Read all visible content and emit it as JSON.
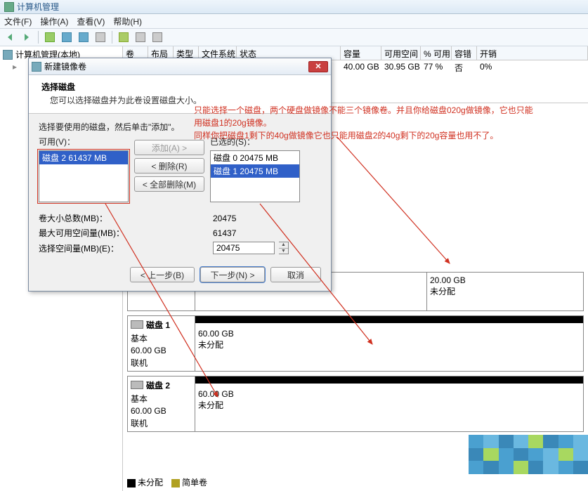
{
  "window": {
    "title": "计算机管理"
  },
  "menu": {
    "file": "文件(F)",
    "action": "操作(A)",
    "view": "查看(V)",
    "help": "帮助(H)"
  },
  "tree": {
    "root": "计算机管理(本地)"
  },
  "columns": {
    "vol": "卷",
    "layout": "布局",
    "type": "类型",
    "fs": "文件系统",
    "status": "状态",
    "cap": "容量",
    "free": "可用空间",
    "pct": "% 可用",
    "fault": "容错",
    "over": "开销"
  },
  "volrow": {
    "cap": "40.00 GB",
    "free": "30.95 GB",
    "pct": "77 %",
    "fault": "否",
    "over": "0%"
  },
  "disk0": {
    "name": "",
    "vol1_size": "",
    "vol1_state": "",
    "vol2_size": "20.00 GB",
    "vol2_state": "未分配"
  },
  "disk1": {
    "name": "磁盘 1",
    "type": "基本",
    "size": "60.00 GB",
    "status": "联机",
    "vol_size": "60.00 GB",
    "vol_state": "未分配"
  },
  "disk2": {
    "name": "磁盘 2",
    "type": "基本",
    "size": "60.00 GB",
    "status": "联机",
    "vol_size": "60.00 GB",
    "vol_state": "未分配"
  },
  "legend": {
    "unalloc": "未分配",
    "simple": "简单卷"
  },
  "dialog": {
    "title": "新建镜像卷",
    "heading": "选择磁盘",
    "subheading": "您可以选择磁盘并为此卷设置磁盘大小。",
    "instruction": "选择要使用的磁盘，然后单击\"添加\"。",
    "available_label": "可用(V)：",
    "selected_label": "已选的(S)：",
    "available_item": "磁盘 2    61437 MB",
    "selected_item0": "磁盘 0    20475 MB",
    "selected_item1": "磁盘 1    20475 MB",
    "btn_add": "添加(A) >",
    "btn_remove": "< 删除(R)",
    "btn_remove_all": "< 全部删除(M)",
    "total_label": "卷大小总数(MB)：",
    "total_val": "20475",
    "max_label": "最大可用空间量(MB)：",
    "max_val": "61437",
    "sel_label": "选择空间量(MB)(E)：",
    "sel_val": "20475",
    "back": "< 上一步(B)",
    "next": "下一步(N) >",
    "cancel": "取消"
  },
  "annotation": {
    "line1": "只能选择一个磁盘，两个硬盘做镜像不能三个镜像卷。并且你给磁盘020g做镜像，它也只能",
    "line2": "用磁盘1的20g镜像。",
    "line3": "同样你把磁盘1剩下的40g做镜像它也只能用磁盘2的40g剩下的20g容量也用不了。"
  }
}
